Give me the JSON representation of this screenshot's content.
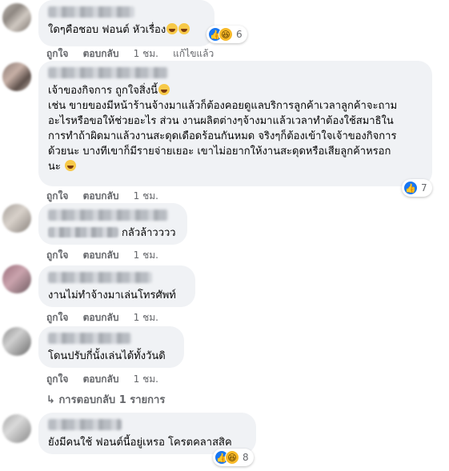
{
  "actions": {
    "like": "ถูกใจ",
    "reply": "ตอบกลับ",
    "edited": "แก้ไขแล้ว"
  },
  "comments": [
    {
      "text": "ใดๆคือชอบ ฟอนต์ หัวเรื่อง",
      "time": "1 ชม.",
      "reactions": {
        "icons": [
          "like-icon",
          "haha-icon"
        ],
        "count": "6"
      }
    },
    {
      "lines": [
        "เจ้าของกิจการ ถูกใจสิ่งนี้",
        "เช่น ขายของมีหน้าร้านจ้างมาแล้วก็ต้องคอยดูแลบริการลูกค้าเวลาลูกค้าจะถาม",
        "อะไรหรือขอให้ช่วยอะไร ส่วน งานผลิตต่างๆจ้างมาแล้วเวลาทำต้องใช้สมาธิใน",
        "การทำถ้าผิดมาแล้วงานสะดุดเดือดร้อนกันหมด จริงๆก็ต้องเข้าใจเจ้าของกิจการ",
        "ด้วยนะ บางทีเขาก็มีรายจ่ายเยอะ เขาไม่อยากให้งานสะดุดหรือเสียลูกค้าหรอก",
        "นะ"
      ],
      "time": "1 ชม.",
      "reactions": {
        "icons": [
          "like-icon"
        ],
        "count": "7"
      }
    },
    {
      "text": "กลัวล้าวววว",
      "time": "1 ชม."
    },
    {
      "text": "งานไม่ทำจ้างมาเล่นโทรศัพท์",
      "time": "1 ชม."
    },
    {
      "text": "โดนปรับกี่นั้งเล่นได้ทั้งวันดิ",
      "time": "1 ชม.",
      "replies_link": "การตอบกลับ 1 รายการ"
    },
    {
      "text": "ยังมีคนใช้ ฟอนต์นี้อยู่เหรอ โครตคลาสสิค",
      "reactions": {
        "icons": [
          "like-icon",
          "haha-icon"
        ],
        "count": "8"
      }
    }
  ]
}
